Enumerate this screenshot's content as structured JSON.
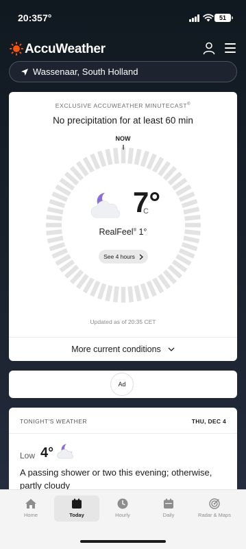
{
  "status_bar": {
    "time": "20:35",
    "temp": "7°",
    "battery": "51"
  },
  "header": {
    "app_name": "AccuWeather"
  },
  "location": {
    "name": "Wassenaar, South Holland"
  },
  "minutecast": {
    "label": "EXCLUSIVE ACCUWEATHER MINUTECAST",
    "label_mark": "®",
    "headline": "No precipitation for at least 60 min",
    "now_label": "NOW",
    "temperature": "7°",
    "unit": "C",
    "realfeel_label": "RealFeel",
    "realfeel_mark": "®",
    "realfeel_value": "1°",
    "see_hours_label": "See 4 hours",
    "updated_text": "Updated as of 20:35 CET",
    "more_conditions_label": "More current conditions",
    "precip_fraction": 0
  },
  "ad": {
    "label": "Ad"
  },
  "tonight": {
    "title": "TONIGHT'S WEATHER",
    "date": "THU, DEC 4",
    "low_label": "Low",
    "low_temp": "4°",
    "description": "A passing shower or two this evening; otherwise, partly cloudy"
  },
  "nav": {
    "items": [
      {
        "label": "Home",
        "icon": "home-icon"
      },
      {
        "label": "Today",
        "icon": "calendar-today-icon",
        "active": true
      },
      {
        "label": "Hourly",
        "icon": "clock-icon"
      },
      {
        "label": "Daily",
        "icon": "calendar-icon"
      },
      {
        "label": "Radar & Maps",
        "icon": "radar-icon"
      }
    ]
  },
  "colors": {
    "brand_orange": "#f05514",
    "moon_purple": "#8b6fd6",
    "background_dark": "#101820"
  }
}
